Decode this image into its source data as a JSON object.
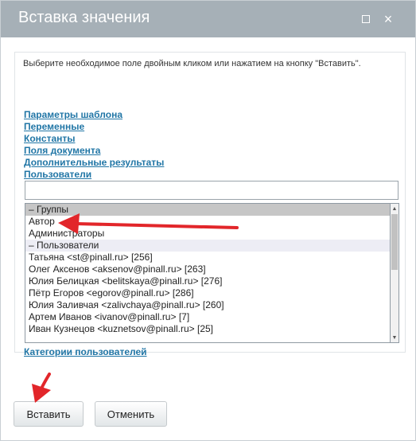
{
  "window": {
    "title": "Вставка значения",
    "maximize_icon": "maximize-icon",
    "close_icon": "close-icon",
    "close_glyph": "×"
  },
  "hint": "Выберите необходимое поле двойным кликом или нажатием на кнопку \"Вставить\".",
  "links": [
    "Параметры шаблона",
    "Переменные",
    "Константы",
    "Поля документа",
    "Дополнительные результаты",
    "Пользователи"
  ],
  "search": {
    "value": "",
    "placeholder": ""
  },
  "list": [
    {
      "label": "– Группы",
      "kind": "group-selected"
    },
    {
      "label": "Автор",
      "kind": "item"
    },
    {
      "label": "Администраторы",
      "kind": "item"
    },
    {
      "label": "– Пользователи",
      "kind": "group"
    },
    {
      "label": "Татьяна <st@pinall.ru> [256]",
      "kind": "item"
    },
    {
      "label": "Олег Аксенов <aksenov@pinall.ru> [263]",
      "kind": "item"
    },
    {
      "label": "Юлия Белицкая <belitskaya@pinall.ru> [276]",
      "kind": "item"
    },
    {
      "label": "Пётр Егоров <egorov@pinall.ru> [286]",
      "kind": "item"
    },
    {
      "label": "Юлия Заливчая <zalivchaya@pinall.ru> [260]",
      "kind": "item"
    },
    {
      "label": "Артем Иванов <ivanov@pinall.ru> [7]",
      "kind": "item"
    },
    {
      "label": "Иван Кузнецов <kuznetsov@pinall.ru> [25]",
      "kind": "item"
    }
  ],
  "categories_link": "Категории пользователей",
  "buttons": {
    "insert": "Вставить",
    "cancel": "Отменить"
  },
  "colors": {
    "titlebar": "#a6b0b7",
    "link": "#2176a6",
    "annotation_arrow": "#e2262a"
  }
}
